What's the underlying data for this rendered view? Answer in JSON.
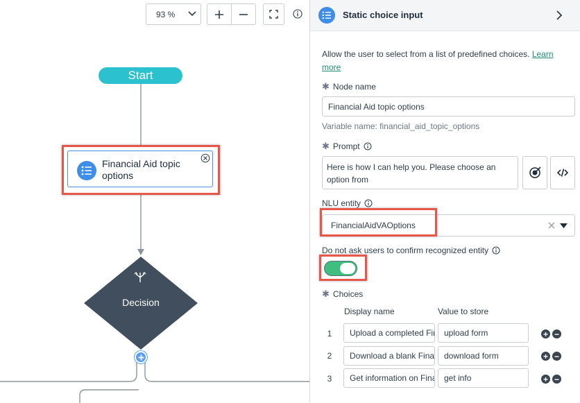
{
  "canvas": {
    "zoom_value": "93 %",
    "start_label": "Start",
    "node_title": "Financial Aid topic options",
    "decision_label": "Decision"
  },
  "panel": {
    "title": "Static choice input",
    "description": "Allow the user to select from a list of predefined choices. ",
    "learn_more": "Learn more",
    "node_name_label": "Node name",
    "node_name_value": "Financial Aid topic options",
    "variable_name": "Variable name: financial_aid_topic_options",
    "prompt_label": "Prompt",
    "prompt_value": "Here is how I can help you. Please choose an option from",
    "nlu_label": "NLU entity",
    "nlu_value": "FinancialAidVAOptions",
    "confirm_label": "Do not ask users to confirm recognized entity",
    "confirm_enabled": true,
    "choices_label": "Choices",
    "col_display": "Display name",
    "col_value": "Value to store",
    "choices": [
      {
        "num": "1",
        "display": "Upload a completed Financial Aid form",
        "value": "upload form"
      },
      {
        "num": "2",
        "display": "Download a blank Financial Aid form",
        "value": "download form"
      },
      {
        "num": "3",
        "display": "Get information on Financial Aid",
        "value": "get info"
      }
    ]
  },
  "colors": {
    "start": "#2bc1cf",
    "node_icon": "#3e8ee8",
    "decision": "#404e5d",
    "highlight": "#e8564a",
    "toggle_on": "#3fbf7f",
    "link": "#1f8c7a"
  }
}
